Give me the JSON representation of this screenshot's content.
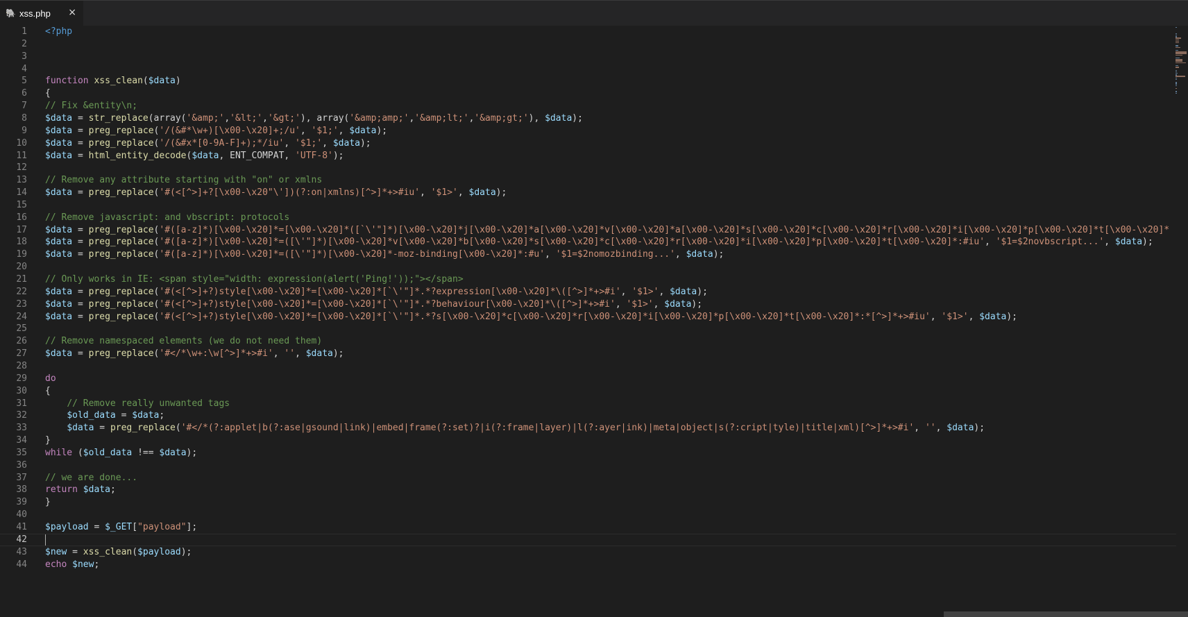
{
  "tab": {
    "title": "xss.php",
    "icon": "php-elephant-icon",
    "close_symbol": "×"
  },
  "editor": {
    "active_line": 42
  },
  "colors": {
    "background": "#1e1e1e",
    "keyword": "#c586c0",
    "function": "#dcdcaa",
    "variable": "#9cdcfe",
    "string": "#ce9178",
    "comment": "#6a9955"
  },
  "lines": [
    [
      [
        "tag",
        "<?php"
      ]
    ],
    [],
    [],
    [],
    [
      [
        "kw",
        "function "
      ],
      [
        "fn",
        "xss_clean"
      ],
      [
        "pl",
        "("
      ],
      [
        "var",
        "$data"
      ],
      [
        "pl",
        ")"
      ]
    ],
    [
      [
        "pl",
        "{"
      ]
    ],
    [
      [
        "com",
        "// Fix &entity\\n;"
      ]
    ],
    [
      [
        "var",
        "$data"
      ],
      [
        "pl",
        " = "
      ],
      [
        "fn",
        "str_replace"
      ],
      [
        "pl",
        "(array("
      ],
      [
        "str",
        "'&amp;'"
      ],
      [
        "pl",
        ","
      ],
      [
        "str",
        "'&lt;'"
      ],
      [
        "pl",
        ","
      ],
      [
        "str",
        "'&gt;'"
      ],
      [
        "pl",
        "), array("
      ],
      [
        "str",
        "'&amp;amp;'"
      ],
      [
        "pl",
        ","
      ],
      [
        "str",
        "'&amp;lt;'"
      ],
      [
        "pl",
        ","
      ],
      [
        "str",
        "'&amp;gt;'"
      ],
      [
        "pl",
        "), "
      ],
      [
        "var",
        "$data"
      ],
      [
        "pl",
        ");"
      ]
    ],
    [
      [
        "var",
        "$data"
      ],
      [
        "pl",
        " = "
      ],
      [
        "fn",
        "preg_replace"
      ],
      [
        "pl",
        "("
      ],
      [
        "str",
        "'/(&#*\\w+)[\\x00-\\x20]+;/u'"
      ],
      [
        "pl",
        ", "
      ],
      [
        "str",
        "'$1;'"
      ],
      [
        "pl",
        ", "
      ],
      [
        "var",
        "$data"
      ],
      [
        "pl",
        ");"
      ]
    ],
    [
      [
        "var",
        "$data"
      ],
      [
        "pl",
        " = "
      ],
      [
        "fn",
        "preg_replace"
      ],
      [
        "pl",
        "("
      ],
      [
        "str",
        "'/(&#x*[0-9A-F]+);*/iu'"
      ],
      [
        "pl",
        ", "
      ],
      [
        "str",
        "'$1;'"
      ],
      [
        "pl",
        ", "
      ],
      [
        "var",
        "$data"
      ],
      [
        "pl",
        ");"
      ]
    ],
    [
      [
        "var",
        "$data"
      ],
      [
        "pl",
        " = "
      ],
      [
        "fn",
        "html_entity_decode"
      ],
      [
        "pl",
        "("
      ],
      [
        "var",
        "$data"
      ],
      [
        "pl",
        ", ENT_COMPAT, "
      ],
      [
        "str",
        "'UTF-8'"
      ],
      [
        "pl",
        ");"
      ]
    ],
    [],
    [
      [
        "com",
        "// Remove any attribute starting with \"on\" or xmlns"
      ]
    ],
    [
      [
        "var",
        "$data"
      ],
      [
        "pl",
        " = "
      ],
      [
        "fn",
        "preg_replace"
      ],
      [
        "pl",
        "("
      ],
      [
        "str",
        "'#(<[^>]+?[\\x00-\\x20\"\\'])(?:on|xmlns)[^>]*+>#iu'"
      ],
      [
        "pl",
        ", "
      ],
      [
        "str",
        "'$1>'"
      ],
      [
        "pl",
        ", "
      ],
      [
        "var",
        "$data"
      ],
      [
        "pl",
        ");"
      ]
    ],
    [],
    [
      [
        "com",
        "// Remove javascript: and vbscript: protocols"
      ]
    ],
    [
      [
        "var",
        "$data"
      ],
      [
        "pl",
        " = "
      ],
      [
        "fn",
        "preg_replace"
      ],
      [
        "pl",
        "("
      ],
      [
        "str",
        "'#([a-z]*)[\\x00-\\x20]*=[\\x00-\\x20]*([`\\'\"]*)[\\x00-\\x20]*j[\\x00-\\x20]*a[\\x00-\\x20]*v[\\x00-\\x20]*a[\\x00-\\x20]*s[\\x00-\\x20]*c[\\x00-\\x20]*r[\\x00-\\x20]*i[\\x00-\\x20]*p[\\x00-\\x20]*t[\\x00-\\x20]*"
      ]
    ],
    [
      [
        "var",
        "$data"
      ],
      [
        "pl",
        " = "
      ],
      [
        "fn",
        "preg_replace"
      ],
      [
        "pl",
        "("
      ],
      [
        "str",
        "'#([a-z]*)[\\x00-\\x20]*=([\\'\"]*)[\\x00-\\x20]*v[\\x00-\\x20]*b[\\x00-\\x20]*s[\\x00-\\x20]*c[\\x00-\\x20]*r[\\x00-\\x20]*i[\\x00-\\x20]*p[\\x00-\\x20]*t[\\x00-\\x20]*:#iu'"
      ],
      [
        "pl",
        ", "
      ],
      [
        "str",
        "'$1=$2novbscript...'"
      ],
      [
        "pl",
        ", "
      ],
      [
        "var",
        "$data"
      ],
      [
        "pl",
        ");"
      ]
    ],
    [
      [
        "var",
        "$data"
      ],
      [
        "pl",
        " = "
      ],
      [
        "fn",
        "preg_replace"
      ],
      [
        "pl",
        "("
      ],
      [
        "str",
        "'#([a-z]*)[\\x00-\\x20]*=([\\'\"]*)[\\x00-\\x20]*-moz-binding[\\x00-\\x20]*:#u'"
      ],
      [
        "pl",
        ", "
      ],
      [
        "str",
        "'$1=$2nomozbinding...'"
      ],
      [
        "pl",
        ", "
      ],
      [
        "var",
        "$data"
      ],
      [
        "pl",
        ");"
      ]
    ],
    [],
    [
      [
        "com",
        "// Only works in IE: <span style=\"width: expression(alert('Ping!'));\"></span>"
      ]
    ],
    [
      [
        "var",
        "$data"
      ],
      [
        "pl",
        " = "
      ],
      [
        "fn",
        "preg_replace"
      ],
      [
        "pl",
        "("
      ],
      [
        "str",
        "'#(<[^>]+?)style[\\x00-\\x20]*=[\\x00-\\x20]*[`\\'\"]*.*?expression[\\x00-\\x20]*\\([^>]*+>#i'"
      ],
      [
        "pl",
        ", "
      ],
      [
        "str",
        "'$1>'"
      ],
      [
        "pl",
        ", "
      ],
      [
        "var",
        "$data"
      ],
      [
        "pl",
        ");"
      ]
    ],
    [
      [
        "var",
        "$data"
      ],
      [
        "pl",
        " = "
      ],
      [
        "fn",
        "preg_replace"
      ],
      [
        "pl",
        "("
      ],
      [
        "str",
        "'#(<[^>]+?)style[\\x00-\\x20]*=[\\x00-\\x20]*[`\\'\"]*.*?behaviour[\\x00-\\x20]*\\([^>]*+>#i'"
      ],
      [
        "pl",
        ", "
      ],
      [
        "str",
        "'$1>'"
      ],
      [
        "pl",
        ", "
      ],
      [
        "var",
        "$data"
      ],
      [
        "pl",
        ");"
      ]
    ],
    [
      [
        "var",
        "$data"
      ],
      [
        "pl",
        " = "
      ],
      [
        "fn",
        "preg_replace"
      ],
      [
        "pl",
        "("
      ],
      [
        "str",
        "'#(<[^>]+?)style[\\x00-\\x20]*=[\\x00-\\x20]*[`\\'\"]*.*?s[\\x00-\\x20]*c[\\x00-\\x20]*r[\\x00-\\x20]*i[\\x00-\\x20]*p[\\x00-\\x20]*t[\\x00-\\x20]*:*[^>]*+>#iu'"
      ],
      [
        "pl",
        ", "
      ],
      [
        "str",
        "'$1>'"
      ],
      [
        "pl",
        ", "
      ],
      [
        "var",
        "$data"
      ],
      [
        "pl",
        ");"
      ]
    ],
    [],
    [
      [
        "com",
        "// Remove namespaced elements (we do not need them)"
      ]
    ],
    [
      [
        "var",
        "$data"
      ],
      [
        "pl",
        " = "
      ],
      [
        "fn",
        "preg_replace"
      ],
      [
        "pl",
        "("
      ],
      [
        "str",
        "'#</*\\w+:\\w[^>]*+>#i'"
      ],
      [
        "pl",
        ", "
      ],
      [
        "str",
        "''"
      ],
      [
        "pl",
        ", "
      ],
      [
        "var",
        "$data"
      ],
      [
        "pl",
        ");"
      ]
    ],
    [],
    [
      [
        "kw",
        "do"
      ]
    ],
    [
      [
        "pl",
        "{"
      ]
    ],
    [
      [
        "pl",
        "    "
      ],
      [
        "com",
        "// Remove really unwanted tags"
      ]
    ],
    [
      [
        "pl",
        "    "
      ],
      [
        "var",
        "$old_data"
      ],
      [
        "pl",
        " = "
      ],
      [
        "var",
        "$data"
      ],
      [
        "pl",
        ";"
      ]
    ],
    [
      [
        "pl",
        "    "
      ],
      [
        "var",
        "$data"
      ],
      [
        "pl",
        " = "
      ],
      [
        "fn",
        "preg_replace"
      ],
      [
        "pl",
        "("
      ],
      [
        "str",
        "'#</*(?:applet|b(?:ase|gsound|link)|embed|frame(?:set)?|i(?:frame|layer)|l(?:ayer|ink)|meta|object|s(?:cript|tyle)|title|xml)[^>]*+>#i'"
      ],
      [
        "pl",
        ", "
      ],
      [
        "str",
        "''"
      ],
      [
        "pl",
        ", "
      ],
      [
        "var",
        "$data"
      ],
      [
        "pl",
        ");"
      ]
    ],
    [
      [
        "pl",
        "}"
      ]
    ],
    [
      [
        "kw",
        "while"
      ],
      [
        "pl",
        " ("
      ],
      [
        "var",
        "$old_data"
      ],
      [
        "pl",
        " !== "
      ],
      [
        "var",
        "$data"
      ],
      [
        "pl",
        ");"
      ]
    ],
    [],
    [
      [
        "com",
        "// we are done..."
      ]
    ],
    [
      [
        "kw",
        "return "
      ],
      [
        "var",
        "$data"
      ],
      [
        "pl",
        ";"
      ]
    ],
    [
      [
        "pl",
        "}"
      ]
    ],
    [],
    [
      [
        "var",
        "$payload"
      ],
      [
        "pl",
        " = "
      ],
      [
        "var",
        "$_GET"
      ],
      [
        "pl",
        "["
      ],
      [
        "str",
        "\"payload\""
      ],
      [
        "pl",
        "];"
      ]
    ],
    [],
    [
      [
        "var",
        "$new"
      ],
      [
        "pl",
        " = "
      ],
      [
        "fn",
        "xss_clean"
      ],
      [
        "pl",
        "("
      ],
      [
        "var",
        "$payload"
      ],
      [
        "pl",
        ");"
      ]
    ],
    [
      [
        "kw",
        "echo "
      ],
      [
        "var",
        "$new"
      ],
      [
        "pl",
        ";"
      ]
    ]
  ]
}
